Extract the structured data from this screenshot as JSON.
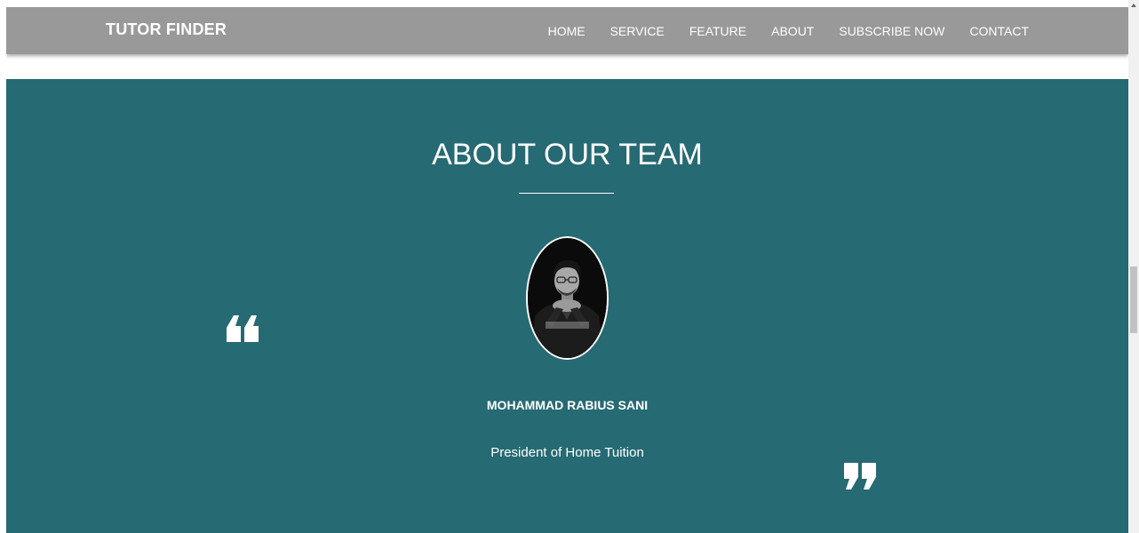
{
  "navbar": {
    "brand": "TUTOR FINDER",
    "links": [
      "HOME",
      "SERVICE",
      "FEATURE",
      "ABOUT",
      "SUBSCRIBE NOW",
      "CONTACT"
    ]
  },
  "about": {
    "title": "ABOUT OUR TEAM",
    "member": {
      "name": "MOHAMMAD RABIUS SANI",
      "role": "President of Home Tuition"
    }
  },
  "icons": {
    "avatar": "person-photo",
    "open_quote": "open-quote-icon",
    "close_quote": "close-quote-icon"
  },
  "colors": {
    "navbar_bg": "#999999",
    "section_bg": "#266a73",
    "text": "#ffffff"
  }
}
